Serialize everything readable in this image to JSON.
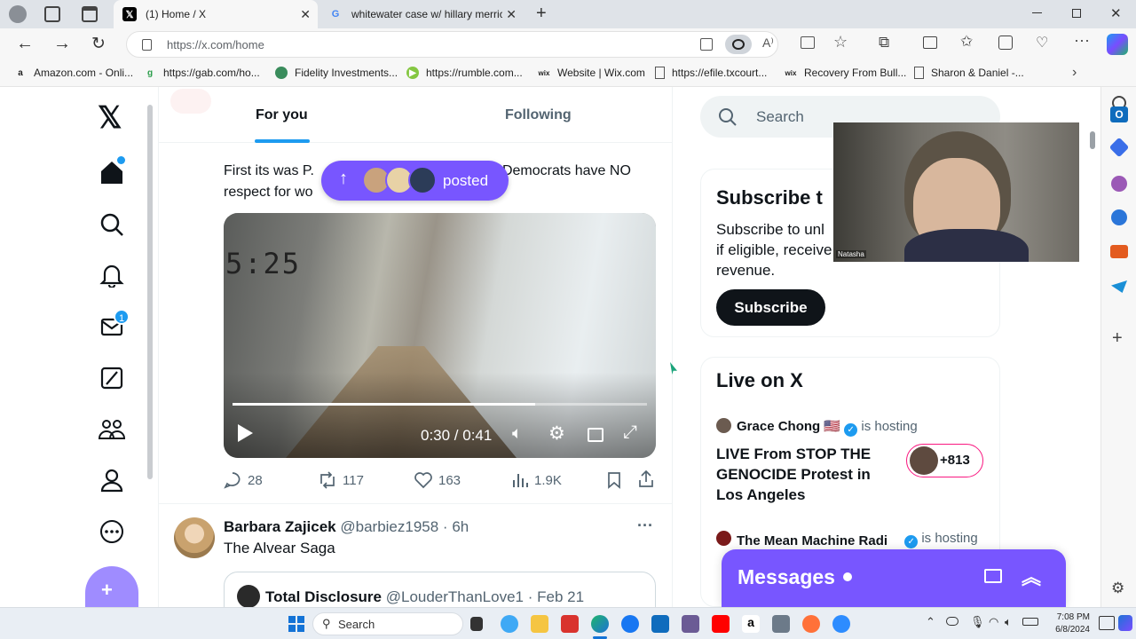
{
  "browser": {
    "tabs": [
      {
        "title": "(1) Home / X",
        "active": true
      },
      {
        "title": "whitewater case w/ hillary merric",
        "active": false
      }
    ],
    "url": "https://x.com/home",
    "bookmarks": [
      {
        "label": "Amazon.com - Onli...",
        "icon": "a"
      },
      {
        "label": "https://gab.com/ho...",
        "icon": "g"
      },
      {
        "label": "Fidelity Investments...",
        "icon": "f"
      },
      {
        "label": "https://rumble.com...",
        "icon": "r"
      },
      {
        "label": "Website | Wix.com",
        "icon": "wix"
      },
      {
        "label": "https://efile.txcourt...",
        "icon": "doc"
      },
      {
        "label": "Recovery From Bull...",
        "icon": "wix"
      },
      {
        "label": "Sharon & Daniel -...",
        "icon": "doc"
      }
    ]
  },
  "feed": {
    "tab_for_you": "For you",
    "tab_following": "Following",
    "new_posts_label": "posted",
    "post_text_a": "First its was P.",
    "post_text_b": "Democrats have NO",
    "post_text_c": "respect for wo",
    "video": {
      "timestamp_overlay": "5:25",
      "time": "0:30 / 0:41",
      "progress": 0.73
    },
    "actions": {
      "replies": "28",
      "reposts": "117",
      "likes": "163",
      "views": "1.9K"
    },
    "next_post": {
      "name": "Barbara Zajicek",
      "handle": "@barbiez1958 · 6h",
      "text": "The Alvear Saga",
      "quote_name": "Total Disclosure",
      "quote_handle": "@LouderThanLove1 · Feb 21"
    },
    "notif_count": "1"
  },
  "right": {
    "search_placeholder": "Search",
    "subscribe_title": "Subscribe t",
    "subscribe_line1": "Subscribe to unl",
    "subscribe_line2": "if eligible, receive",
    "subscribe_line3": "revenue.",
    "subscribe_button": "Subscribe",
    "live_title": "Live on X",
    "live1_host": "Grace Chong 🇺🇸",
    "live1_suffix": "is hosting",
    "live1_title": "LIVE From STOP THE GENOCIDE Protest in Los Angeles",
    "live1_count": "+813",
    "live2_host": "The Mean Machine Radi",
    "live2_suffix": "is hosting",
    "messages_label": "Messages"
  },
  "webcam": {
    "name": "Natasha"
  },
  "taskbar": {
    "search": "Search",
    "time": "7:08 PM",
    "date": "6/8/2024"
  },
  "colors": {
    "accent": "#1d9bf0",
    "purple": "#7856ff",
    "brand": "#0f1419"
  }
}
